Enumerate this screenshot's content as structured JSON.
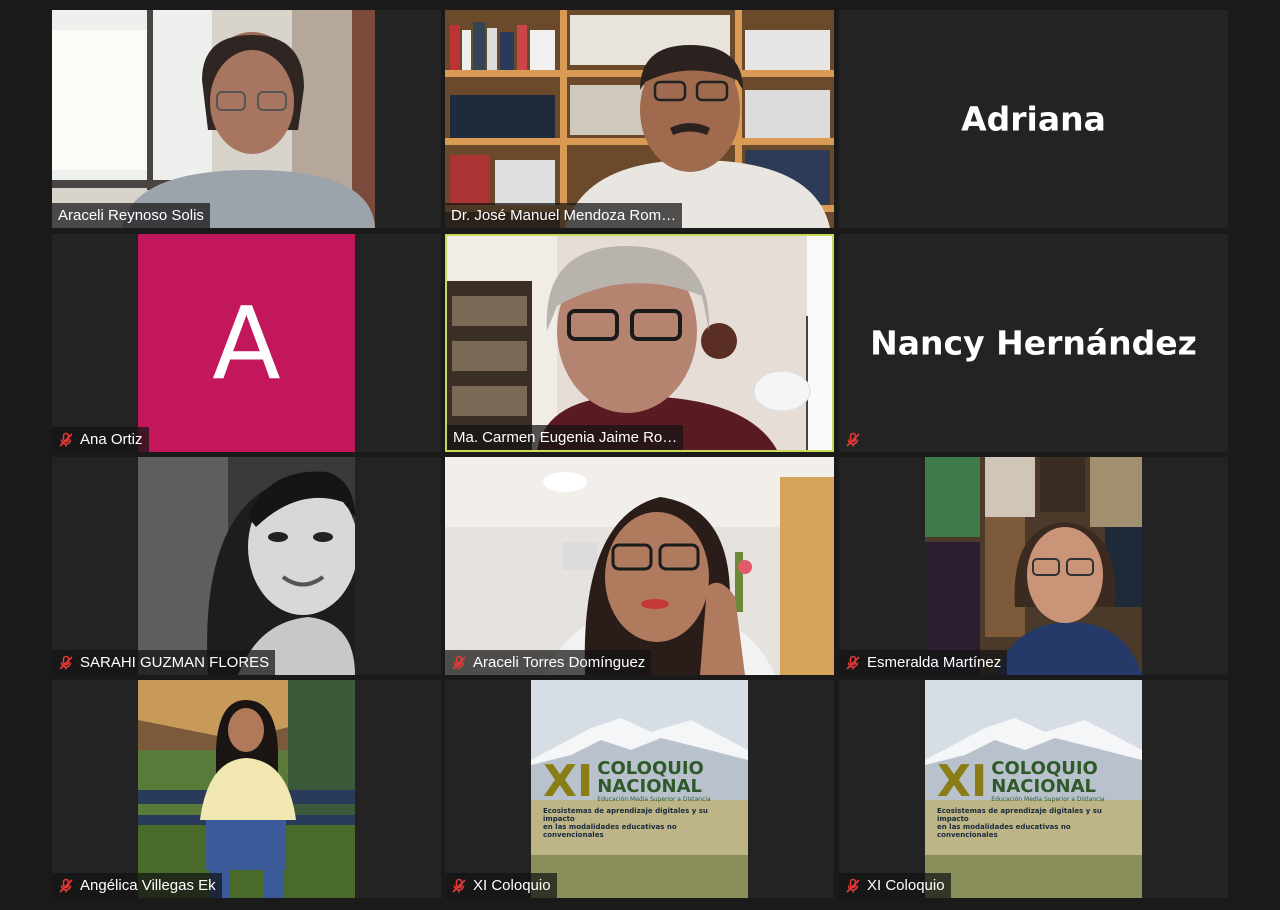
{
  "colors": {
    "background": "#1a1a1a",
    "tile": "#232323",
    "active_speaker_border": "#c9d856",
    "avatar_magenta": "#c2185b",
    "mute_icon": "#e53935"
  },
  "participants": [
    {
      "name": "Araceli Reynoso Solis",
      "muted": false,
      "video": true
    },
    {
      "name": "Dr. José Manuel Mendoza Rom…",
      "muted": false,
      "video": true
    },
    {
      "name": "Adriana",
      "muted": false,
      "video": false
    },
    {
      "name": "Ana Ortiz",
      "muted": true,
      "video": false,
      "avatar_letter": "A"
    },
    {
      "name": "Ma. Carmen Eugenia Jaime Ro…",
      "muted": false,
      "video": true,
      "active_speaker": true
    },
    {
      "name": "Nancy Hernández",
      "muted": true,
      "video": false
    },
    {
      "name": "SARAHI GUZMAN FLORES",
      "muted": true,
      "video": true
    },
    {
      "name": "Araceli Torres Domínguez",
      "muted": true,
      "video": true
    },
    {
      "name": "Esmeralda Martínez",
      "muted": true,
      "video": true
    },
    {
      "name": "Angélica Villegas Ek",
      "muted": true,
      "video": true
    },
    {
      "name": "XI Coloquio",
      "muted": true,
      "video": true
    },
    {
      "name": "XI Coloquio",
      "muted": true,
      "video": true
    }
  ],
  "poster": {
    "numeral": "XI",
    "line1": "COLOQUIO",
    "line2": "NACIONAL",
    "subtitle": "Educación Media Superior a Distancia",
    "desc1": "Ecosistemas de aprendizaje digitales y su impacto",
    "desc2": "en las modalidades educativas no convencionales"
  }
}
